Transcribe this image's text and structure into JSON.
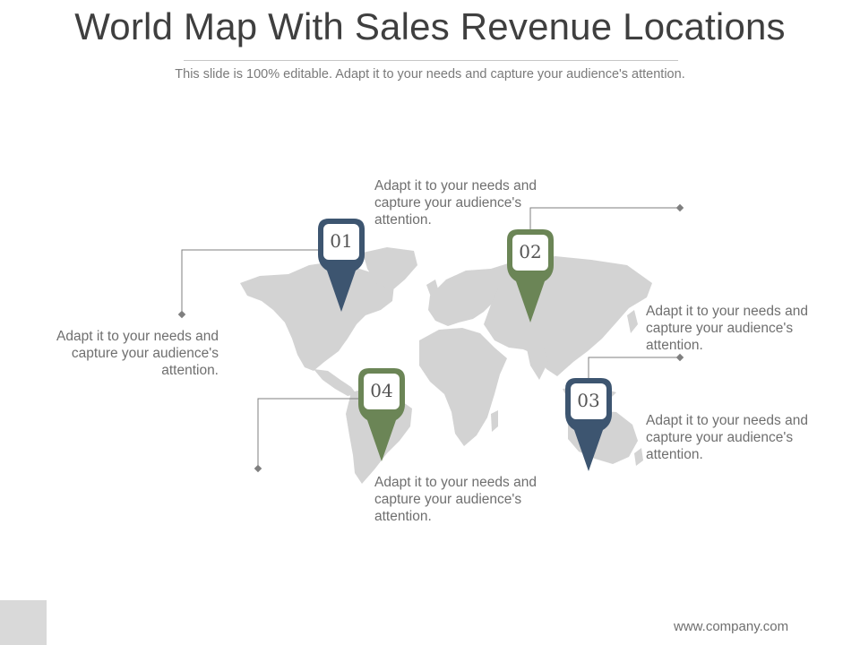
{
  "slide": {
    "title": "World Map With Sales Revenue Locations",
    "subtitle": "This slide is 100% editable. Adapt it to your needs and capture your audience's attention.",
    "footer": "www.company.com"
  },
  "colors": {
    "map_fill": "#d3d3d3",
    "pin_blue": "#3d5570",
    "pin_green": "#6b8556",
    "connector": "#7f7f7f",
    "corner_box": "#d9d9d9"
  },
  "pins": [
    {
      "number": "01",
      "color": "blue",
      "icon": "location-pin-icon"
    },
    {
      "number": "02",
      "color": "green",
      "icon": "location-pin-icon"
    },
    {
      "number": "03",
      "color": "blue",
      "icon": "location-pin-icon"
    },
    {
      "number": "04",
      "color": "green",
      "icon": "location-pin-icon"
    }
  ],
  "callouts": {
    "top": "Adapt it to your needs and capture your audience's attention.",
    "left": "Adapt it to your needs and capture your audience's attention.",
    "right_upper": "Adapt it to your needs and capture your audience's attention.",
    "right_lower": "Adapt it to your needs and capture your audience's attention.",
    "bottom": "Adapt it to your needs and capture your audience's attention."
  }
}
